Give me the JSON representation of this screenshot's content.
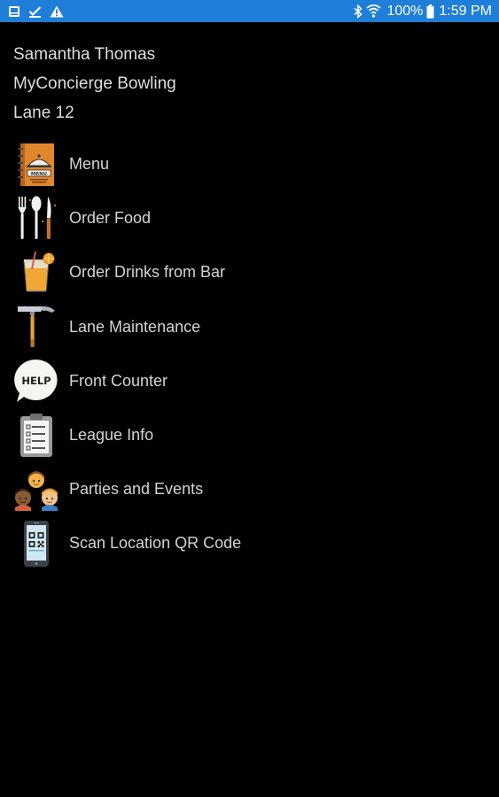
{
  "statusbar": {
    "battery_percent": "100%",
    "time": "1:59 PM",
    "colors": {
      "background": "#1e7ed8"
    }
  },
  "header": {
    "user_name": "Samantha Thomas",
    "venue": "MyConcierge Bowling",
    "lane": "Lane 12"
  },
  "menu": {
    "items": [
      {
        "label": "Menu",
        "icon": "restaurant-menu-icon"
      },
      {
        "label": "Order Food",
        "icon": "cutlery-icon"
      },
      {
        "label": "Order Drinks from Bar",
        "icon": "drink-glass-icon"
      },
      {
        "label": "Lane Maintenance",
        "icon": "hammer-icon"
      },
      {
        "label": "Front Counter",
        "icon": "help-bubble-icon",
        "icon_text": "HELP"
      },
      {
        "label": "League Info",
        "icon": "clipboard-icon"
      },
      {
        "label": "Parties and Events",
        "icon": "people-icon"
      },
      {
        "label": "Scan Location QR Code",
        "icon": "qr-phone-icon"
      }
    ]
  }
}
